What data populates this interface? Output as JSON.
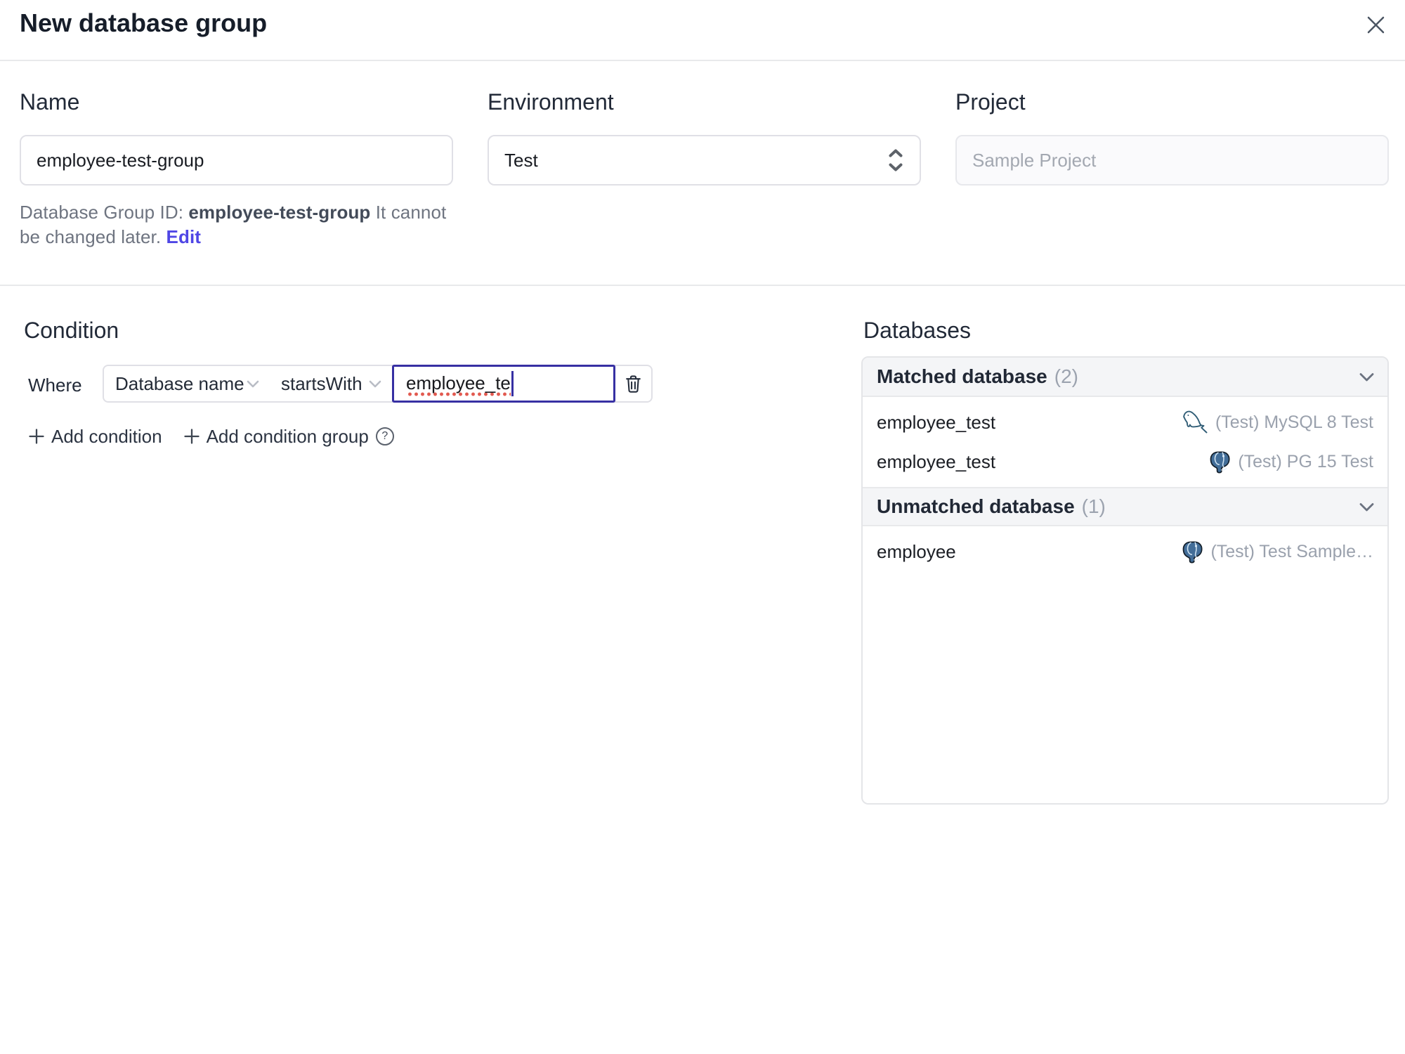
{
  "dialog": {
    "title": "New database group"
  },
  "form": {
    "name": {
      "label": "Name",
      "value": "employee-test-group"
    },
    "environment": {
      "label": "Environment",
      "value": "Test"
    },
    "project": {
      "label": "Project",
      "value": "Sample Project"
    },
    "id_hint": {
      "prefix": "Database Group ID: ",
      "id": "employee-test-group",
      "suffix": " It cannot be changed later. ",
      "edit_label": "Edit"
    }
  },
  "condition": {
    "heading": "Condition",
    "where_label": "Where",
    "factor": "Database name",
    "operator": "startsWith",
    "value": "employee_te",
    "add_condition_label": "Add condition",
    "add_condition_group_label": "Add condition group",
    "help_glyph": "?"
  },
  "databases": {
    "heading": "Databases",
    "matched": {
      "title": "Matched database",
      "count": "(2)",
      "rows": [
        {
          "name": "employee_test",
          "engine": "mysql",
          "instance": "(Test) MySQL 8 Test"
        },
        {
          "name": "employee_test",
          "engine": "postgres",
          "instance": "(Test) PG 15 Test"
        }
      ]
    },
    "unmatched": {
      "title": "Unmatched database",
      "count": "(1)",
      "rows": [
        {
          "name": "employee",
          "engine": "postgres",
          "instance": "(Test) Test Sample…"
        }
      ]
    }
  },
  "colors": {
    "accent": "#4f46e5",
    "focus_border": "#3730a3",
    "spellcheck": "#e2594f",
    "divider": "#e8e9eb",
    "input_border": "#e0e0e6",
    "muted_text": "#9aa1ad",
    "postgres_blue": "#336791",
    "mysql_teal": "#3f6e8c"
  }
}
